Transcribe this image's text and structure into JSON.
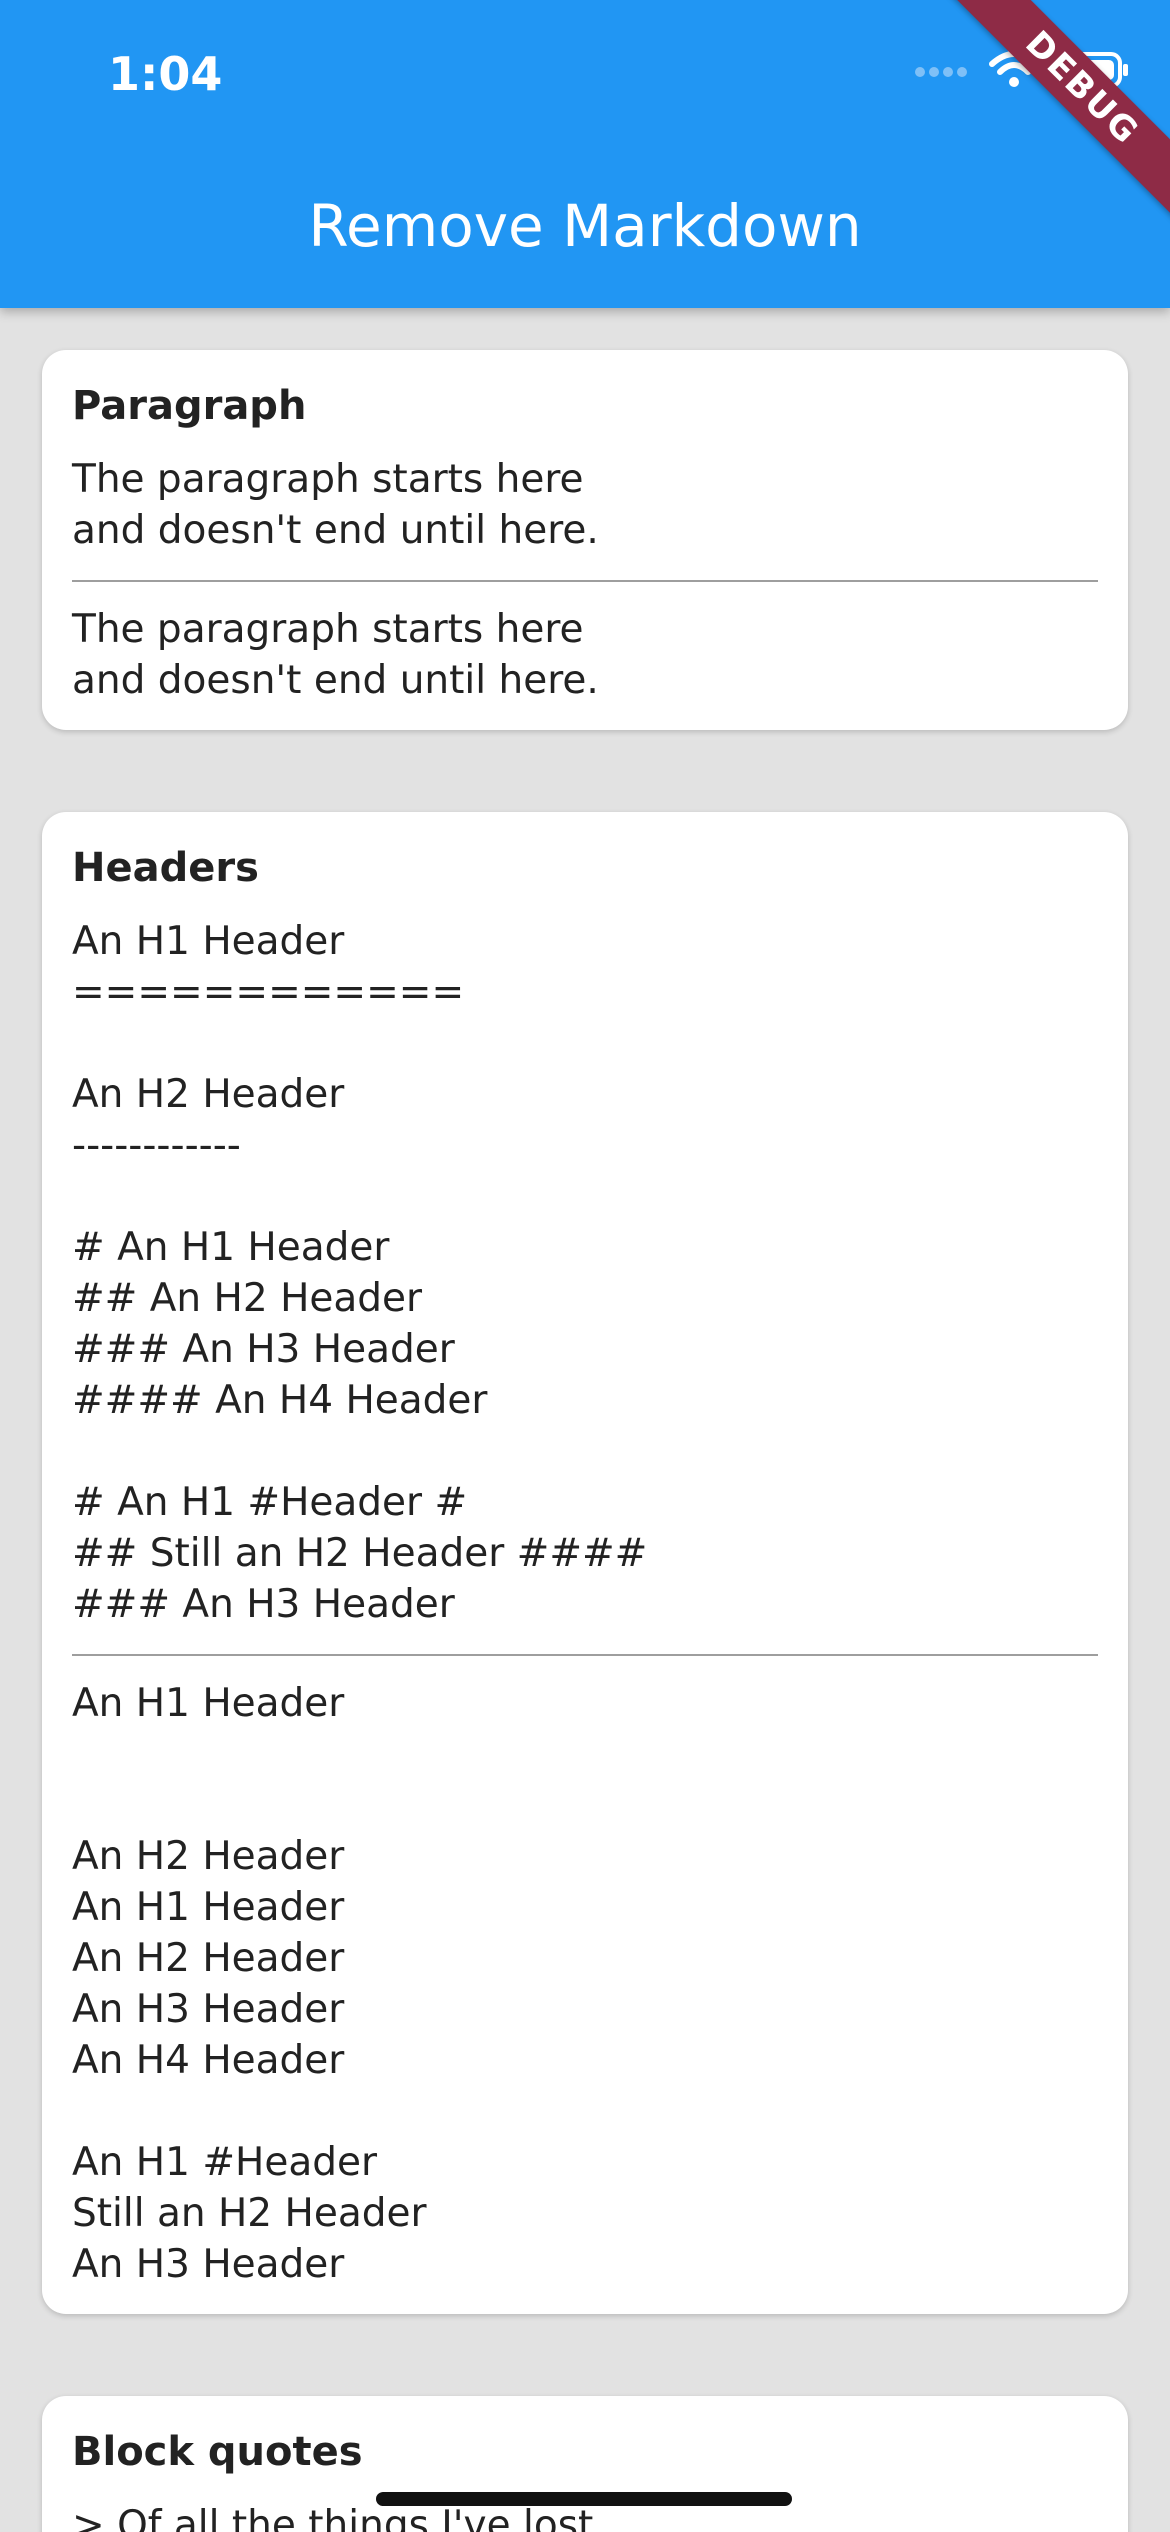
{
  "status_bar": {
    "time": "1:04"
  },
  "app_bar": {
    "title": "Remove Markdown",
    "debug_label": "DEBUG",
    "color": "#2196f3"
  },
  "cards": [
    {
      "title": "Paragraph",
      "input": "The paragraph starts here\nand doesn't end until here.",
      "output": "The paragraph starts here\nand doesn't end until here."
    },
    {
      "title": "Headers",
      "input": "An H1 Header\n============\n\nAn H2 Header\n------------\n\n# An H1 Header\n## An H2 Header\n### An H3 Header\n#### An H4 Header\n\n# An H1 #Header #\n## Still an H2 Header ####\n### An H3 Header",
      "output": "An H1 Header\n\n\nAn H2 Header\nAn H1 Header\nAn H2 Header\nAn H3 Header\nAn H4 Header\n\nAn H1 #Header\nStill an H2 Header\nAn H3 Header"
    },
    {
      "title": "Block quotes",
      "input": "> Of all the things I've lost"
    }
  ]
}
